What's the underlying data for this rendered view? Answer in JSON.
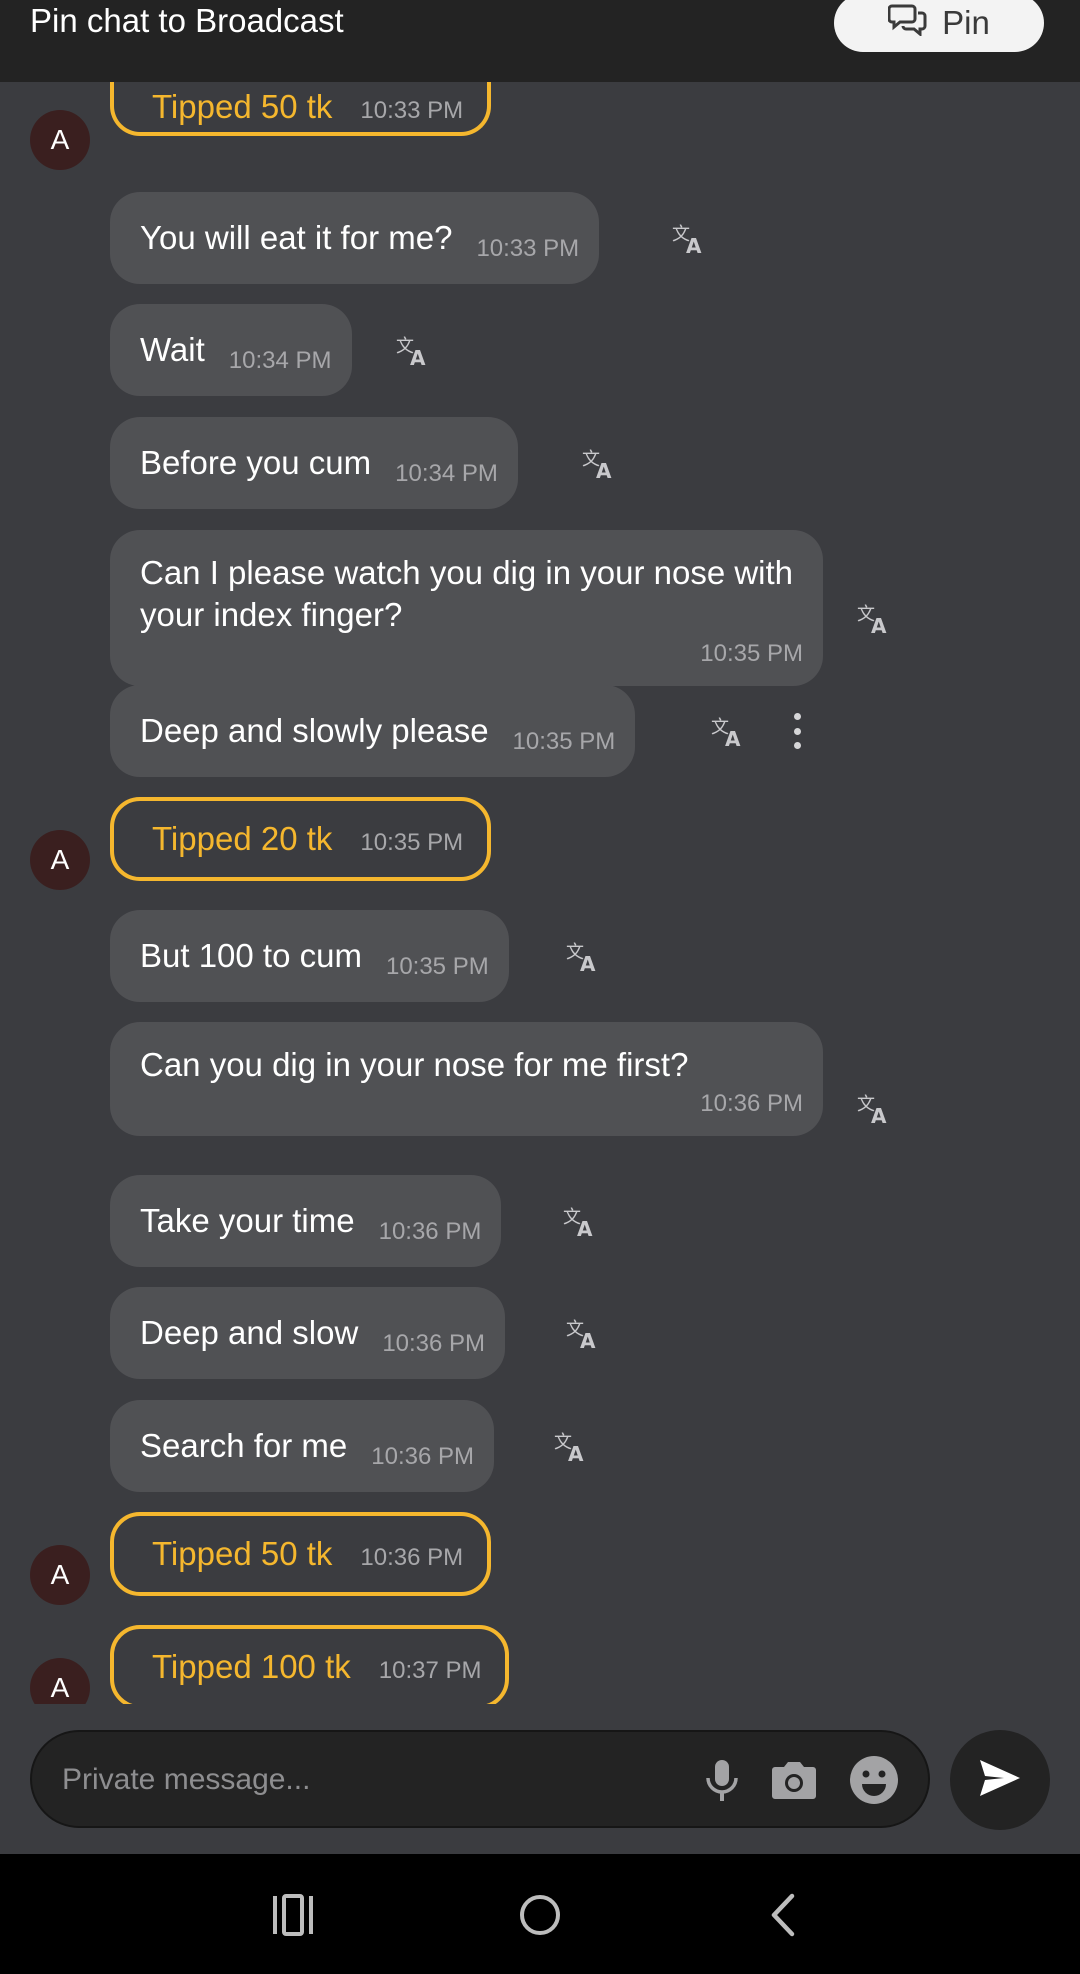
{
  "header": {
    "title": "Pin chat to Broadcast",
    "pin_label": "Pin"
  },
  "messages": [
    {
      "type": "tip",
      "avatar": "A",
      "text": "Tipped 50 tk",
      "time": "10:33 PM"
    },
    {
      "type": "text",
      "text": "You will eat it for me?",
      "time": "10:33 PM"
    },
    {
      "type": "text",
      "text": "Wait",
      "time": "10:34 PM"
    },
    {
      "type": "text",
      "text": "Before you cum",
      "time": "10:34 PM"
    },
    {
      "type": "text",
      "text": "Can I please watch you dig in your nose with your index finger?",
      "time": "10:35 PM"
    },
    {
      "type": "text",
      "text": "Deep and slowly please",
      "time": "10:35 PM"
    },
    {
      "type": "tip",
      "avatar": "A",
      "text": "Tipped 20 tk",
      "time": "10:35 PM"
    },
    {
      "type": "text",
      "text": "But 100 to cum",
      "time": "10:35 PM"
    },
    {
      "type": "text",
      "text": "Can you dig in your nose for me first?",
      "time": "10:36 PM"
    },
    {
      "type": "text",
      "text": "Take your time",
      "time": "10:36 PM"
    },
    {
      "type": "text",
      "text": "Deep and slow",
      "time": "10:36 PM"
    },
    {
      "type": "text",
      "text": "Search for me",
      "time": "10:36 PM"
    },
    {
      "type": "tip",
      "avatar": "A",
      "text": "Tipped 50 tk",
      "time": "10:36 PM"
    },
    {
      "type": "tip",
      "avatar": "A",
      "text": "Tipped 100 tk",
      "time": "10:37 PM"
    }
  ],
  "composer": {
    "placeholder": "Private message...",
    "icons": [
      "microphone-icon",
      "camera-icon",
      "emoji-icon",
      "send-icon"
    ]
  },
  "nav": {
    "icons": [
      "recent-apps-icon",
      "home-icon",
      "back-icon"
    ]
  },
  "colors": {
    "background": "#3b3c40",
    "bubble": "#505154",
    "tip_accent": "#f5b72e",
    "header": "#232323"
  }
}
